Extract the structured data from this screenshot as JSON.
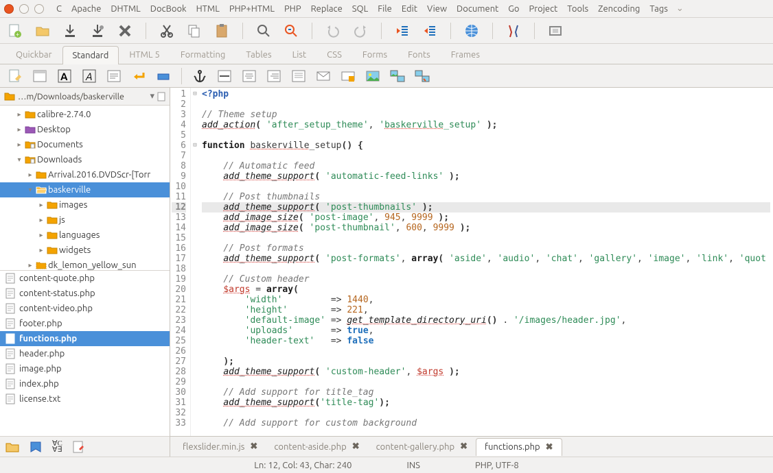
{
  "menus": [
    "C",
    "Apache",
    "DHTML",
    "DocBook",
    "HTML",
    "PHP+HTML",
    "PHP",
    "Replace",
    "SQL",
    "File",
    "Edit",
    "View",
    "Document",
    "Go",
    "Project",
    "Tools",
    "Zencoding",
    "Tags"
  ],
  "tabs": [
    "Quickbar",
    "Standard",
    "HTML 5",
    "Formatting",
    "Tables",
    "List",
    "CSS",
    "Forms",
    "Fonts",
    "Frames"
  ],
  "active_tab": 1,
  "pathbar": "…m/Downloads/baskerville",
  "tree": [
    {
      "indent": 1,
      "toggle": "▸",
      "icon": "folder",
      "label": "calibre-2.74.0"
    },
    {
      "indent": 1,
      "toggle": "▸",
      "icon": "folder-purple",
      "label": "Desktop"
    },
    {
      "indent": 1,
      "toggle": "▸",
      "icon": "folder-doc",
      "label": "Documents"
    },
    {
      "indent": 1,
      "toggle": "▾",
      "icon": "folder-doc",
      "label": "Downloads"
    },
    {
      "indent": 2,
      "toggle": "▸",
      "icon": "folder",
      "label": "Arrival.2016.DVDScr-[Torr"
    },
    {
      "indent": 2,
      "toggle": "▾",
      "icon": "folder-open",
      "label": "baskerville",
      "selected": true
    },
    {
      "indent": 3,
      "toggle": "▸",
      "icon": "folder",
      "label": "images"
    },
    {
      "indent": 3,
      "toggle": "▸",
      "icon": "folder",
      "label": "js"
    },
    {
      "indent": 3,
      "toggle": "▸",
      "icon": "folder",
      "label": "languages"
    },
    {
      "indent": 3,
      "toggle": "▸",
      "icon": "folder",
      "label": "widgets"
    },
    {
      "indent": 2,
      "toggle": "▸",
      "icon": "folder-cut",
      "label": "dk_lemon_yellow_sun"
    }
  ],
  "files": [
    {
      "name": "content-quote.php"
    },
    {
      "name": "content-status.php"
    },
    {
      "name": "content-video.php"
    },
    {
      "name": "footer.php"
    },
    {
      "name": "functions.php",
      "selected": true
    },
    {
      "name": "header.php"
    },
    {
      "name": "image.php"
    },
    {
      "name": "index.php"
    },
    {
      "name": "license.txt"
    }
  ],
  "filetabs": [
    {
      "label": "flexslider.min.js",
      "close": true
    },
    {
      "label": "content-aside.php",
      "close": true
    },
    {
      "label": "content-gallery.php",
      "close": true
    },
    {
      "label": "functions.php",
      "close": true,
      "active": true
    }
  ],
  "status": {
    "pos": "Ln: 12, Col: 43, Char: 240",
    "ins": "INS",
    "mode": "PHP, UTF-8"
  },
  "code": {
    "lines": [
      {
        "n": 1,
        "fold": "⊟",
        "html": "<span class='php'>&lt;?php</span>"
      },
      {
        "n": 2,
        "html": ""
      },
      {
        "n": 3,
        "html": "<span class='com'>// Theme setup</span>"
      },
      {
        "n": 4,
        "html": "<span class='fn'>add_action</span><span class='op'>(</span> <span class='str'>'after_setup_theme'</span>, <span class='str'>'<span class='ud'>baskerville</span>_setup'</span> <span class='op'>);</span>"
      },
      {
        "n": 5,
        "html": ""
      },
      {
        "n": 6,
        "fold": "⊟",
        "html": "<span class='kw'>function</span> <span class='ud'>baskerville</span>_setup<span class='op'>() {</span>"
      },
      {
        "n": 7,
        "html": ""
      },
      {
        "n": 8,
        "html": "    <span class='com'>// Automatic feed</span>"
      },
      {
        "n": 9,
        "html": "    <span class='fn'>add_theme_support</span><span class='op'>(</span> <span class='str'>'automatic-feed-links'</span> <span class='op'>);</span>"
      },
      {
        "n": 10,
        "html": ""
      },
      {
        "n": 11,
        "html": "    <span class='com'>// Post thumbnails</span>"
      },
      {
        "n": 12,
        "hl": true,
        "html": "    <span class='fn'>add_theme_support</span><span class='op'>(</span> <span class='str'>'post-thumbnails'</span> <span class='op'>);</span>"
      },
      {
        "n": 13,
        "html": "    <span class='fn'>add_image_size</span><span class='op'>(</span> <span class='str'>'post-image'</span>, <span class='num'>945</span>, <span class='num'>9999</span> <span class='op'>);</span>"
      },
      {
        "n": 14,
        "html": "    <span class='fn'>add_image_size</span><span class='op'>(</span> <span class='str'>'post-thumbnail'</span>, <span class='num'>600</span>, <span class='num'>9999</span> <span class='op'>);</span>"
      },
      {
        "n": 15,
        "html": ""
      },
      {
        "n": 16,
        "html": "    <span class='com'>// Post formats</span>"
      },
      {
        "n": 17,
        "html": "    <span class='fn'>add_theme_support</span><span class='op'>(</span> <span class='str'>'post-formats'</span>, <span class='kw'>array</span><span class='op'>(</span> <span class='str'>'aside'</span>, <span class='str'>'audio'</span>, <span class='str'>'chat'</span>, <span class='str'>'gallery'</span>, <span class='str'>'image'</span>, <span class='str'>'link'</span>, <span class='str'>'quot</span>"
      },
      {
        "n": 18,
        "html": ""
      },
      {
        "n": 19,
        "html": "    <span class='com'>// Custom header</span>"
      },
      {
        "n": 20,
        "html": "    <span class='var'>$args</span> = <span class='kw'>array</span><span class='op'>(</span>"
      },
      {
        "n": 21,
        "html": "        <span class='str'>'width'</span>         =&gt; <span class='num'>1440</span>,"
      },
      {
        "n": 22,
        "html": "        <span class='str'>'height'</span>        =&gt; <span class='num'>221</span>,"
      },
      {
        "n": 23,
        "html": "        <span class='str'>'default-image'</span> =&gt; <span class='fn'>get_template_directory_uri</span><span class='op'>()</span> . <span class='str'>'/images/header.jpg'</span>,"
      },
      {
        "n": 24,
        "html": "        <span class='str'>'uploads'</span>       =&gt; <span class='bool'>true</span>,"
      },
      {
        "n": 25,
        "html": "        <span class='str'>'header-text'</span>   =&gt; <span class='bool'>false</span>"
      },
      {
        "n": 26,
        "html": ""
      },
      {
        "n": 27,
        "html": "    <span class='op'>);</span>"
      },
      {
        "n": 28,
        "html": "    <span class='fn'>add_theme_support</span><span class='op'>(</span> <span class='str'>'custom-header'</span>, <span class='var'>$args</span> <span class='op'>);</span>"
      },
      {
        "n": 29,
        "html": ""
      },
      {
        "n": 30,
        "html": "    <span class='com'>// Add support for title_tag</span>"
      },
      {
        "n": 31,
        "html": "    <span class='fn'>add_theme_support</span><span class='op'>(</span><span class='str'>'title-tag'</span><span class='op'>);</span>"
      },
      {
        "n": 32,
        "html": ""
      },
      {
        "n": 33,
        "html": "    <span class='com'>// Add support for custom background</span>"
      }
    ]
  }
}
